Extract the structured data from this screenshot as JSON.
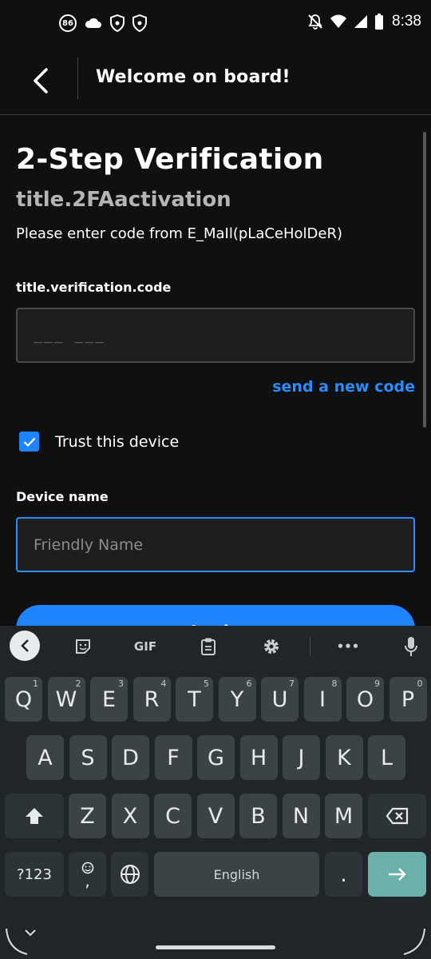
{
  "status_bar": {
    "badge_text": "86",
    "time": "8:38"
  },
  "header": {
    "title": "Welcome on board!"
  },
  "main": {
    "heading": "2-Step Verification",
    "subheading": "title.2FAactivation",
    "instruction": "Please enter code from E_MaIl(pLaCeHolDeR)",
    "code_label": "title.verification.code",
    "code_placeholder": "___  ___",
    "send_new_code": "send a new code",
    "trust_label": "Trust this device",
    "trust_checked": true,
    "device_name_label": "Device name",
    "device_name_placeholder": "Friendly Name",
    "primary_button_label": "Login",
    "colors": {
      "accent": "#1e84ff",
      "link": "#2a8cff",
      "background": "#101010"
    }
  },
  "keyboard": {
    "toolbar": {
      "gif_label": "GIF",
      "more_label": "•••"
    },
    "row1": [
      {
        "k": "Q",
        "h": "1"
      },
      {
        "k": "W",
        "h": "2"
      },
      {
        "k": "E",
        "h": "3"
      },
      {
        "k": "R",
        "h": "4"
      },
      {
        "k": "T",
        "h": "5"
      },
      {
        "k": "Y",
        "h": "6"
      },
      {
        "k": "U",
        "h": "7"
      },
      {
        "k": "I",
        "h": "8"
      },
      {
        "k": "O",
        "h": "9"
      },
      {
        "k": "P",
        "h": "0"
      }
    ],
    "row2": [
      "A",
      "S",
      "D",
      "F",
      "G",
      "H",
      "J",
      "K",
      "L"
    ],
    "row3": [
      "Z",
      "X",
      "C",
      "V",
      "B",
      "N",
      "M"
    ],
    "symbols_label": "?123",
    "emoji_comma": ",",
    "space_label": "English",
    "period_label": ".",
    "accent_color": "#6bb0a9"
  }
}
